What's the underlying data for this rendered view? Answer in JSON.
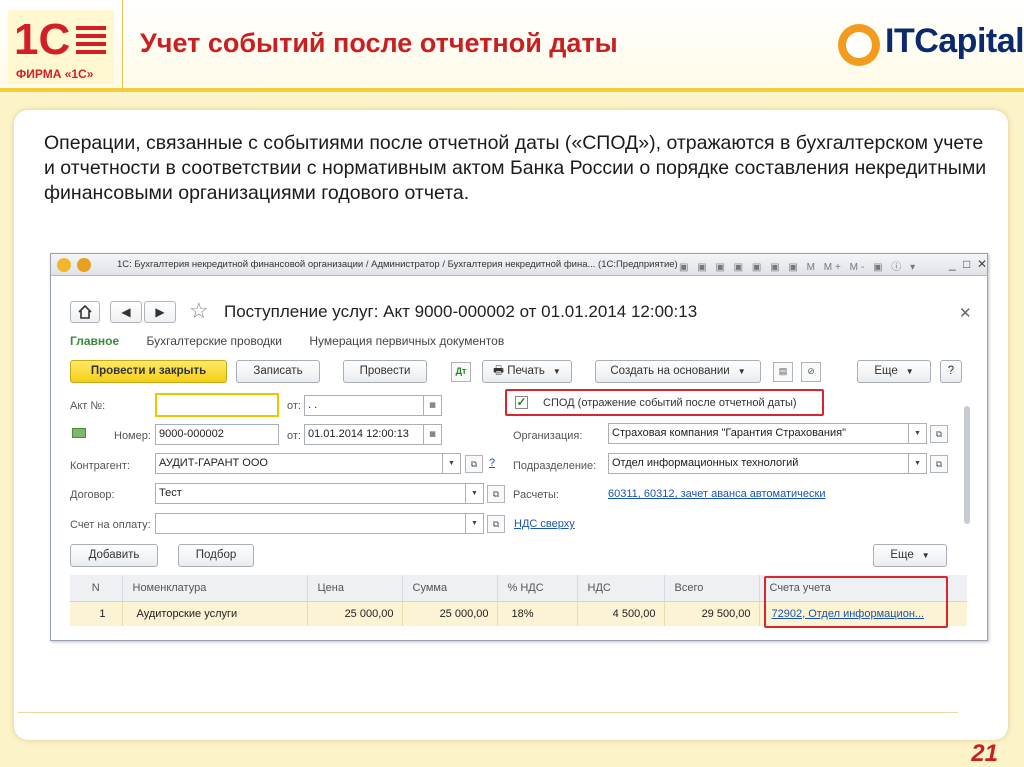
{
  "slide": {
    "title": "Учет событий после отчетной даты",
    "logo_1c_text": "ФИРМА «1С»",
    "brand_logo_text": "ITCapital",
    "lead_text": "Операции, связанные с событиями после отчетной даты («СПОД»), отражаются в бухгалтерском учете и отчетности в соответствии с нормативным актом Банка России о порядке составления некредитными финансовыми организациями годового отчета.",
    "page_number": "21"
  },
  "window": {
    "title": "1С: Бухгалтерия некредитной финансовой организации / Администратор / Бухгалтерия некредитной фина... (1С:Предприятие)",
    "toolbar_glyphs": "▣ ▣ ▣ ▣  ▣ ▣ ▣  M M+ M-  ▣ ⓘ ▾",
    "controls": [
      "_",
      "□",
      "✕"
    ]
  },
  "document": {
    "title": "Поступление услуг: Акт 9000-000002 от 01.01.2014 12:00:13",
    "tabs": [
      "Главное",
      "Бухгалтерские проводки",
      "Нумерация первичных документов"
    ],
    "buttons": {
      "post_close": "Провести и закрыть",
      "save": "Записать",
      "post": "Провести",
      "print": "Печать",
      "create_based": "Создать на основании",
      "more": "Еще",
      "help": "?",
      "add": "Добавить",
      "select": "Подбор",
      "more2": "Еще"
    },
    "fields": {
      "act_no_label": "Акт №:",
      "act_no_value": "",
      "act_date_label": "от:",
      "act_date_value": " .  .",
      "number_label": "Номер:",
      "number_value": "9000-000002",
      "date_label": "от:",
      "date_value": "01.01.2014 12:00:13",
      "spod_label": "СПОД (отражение событий после отчетной даты)",
      "org_label": "Организация:",
      "org_value": "Страховая компания \"Гарантия Страхования\"",
      "contractor_label": "Контрагент:",
      "contractor_value": "АУДИТ-ГАРАНТ ООО",
      "dept_label": "Подразделение:",
      "dept_value": "Отдел информационных технологий",
      "contract_label": "Договор:",
      "contract_value": "Тест",
      "settlements_label": "Расчеты:",
      "settlements_link": "60311, 60312, зачет аванса автоматически",
      "invoice_label": "Счет на оплату:",
      "invoice_value": "",
      "vat_link": "НДС сверху",
      "help_q": "?"
    },
    "table": {
      "columns": [
        "N",
        "Номенклатура",
        "Цена",
        "Сумма",
        "% НДС",
        "НДС",
        "Всего",
        "Счета учета"
      ],
      "rows": [
        [
          "1",
          "Аудиторские услуги",
          "25 000,00",
          "25 000,00",
          "18%",
          "4 500,00",
          "29 500,00",
          "72902, Отдел информацион..."
        ]
      ]
    }
  },
  "colors": {
    "title_red": "#c82020",
    "accent_yellow": "#f4cf18",
    "highlight_red": "#d7262c",
    "link_blue": "#1a55b0",
    "tab_green": "#3a8a3a"
  }
}
